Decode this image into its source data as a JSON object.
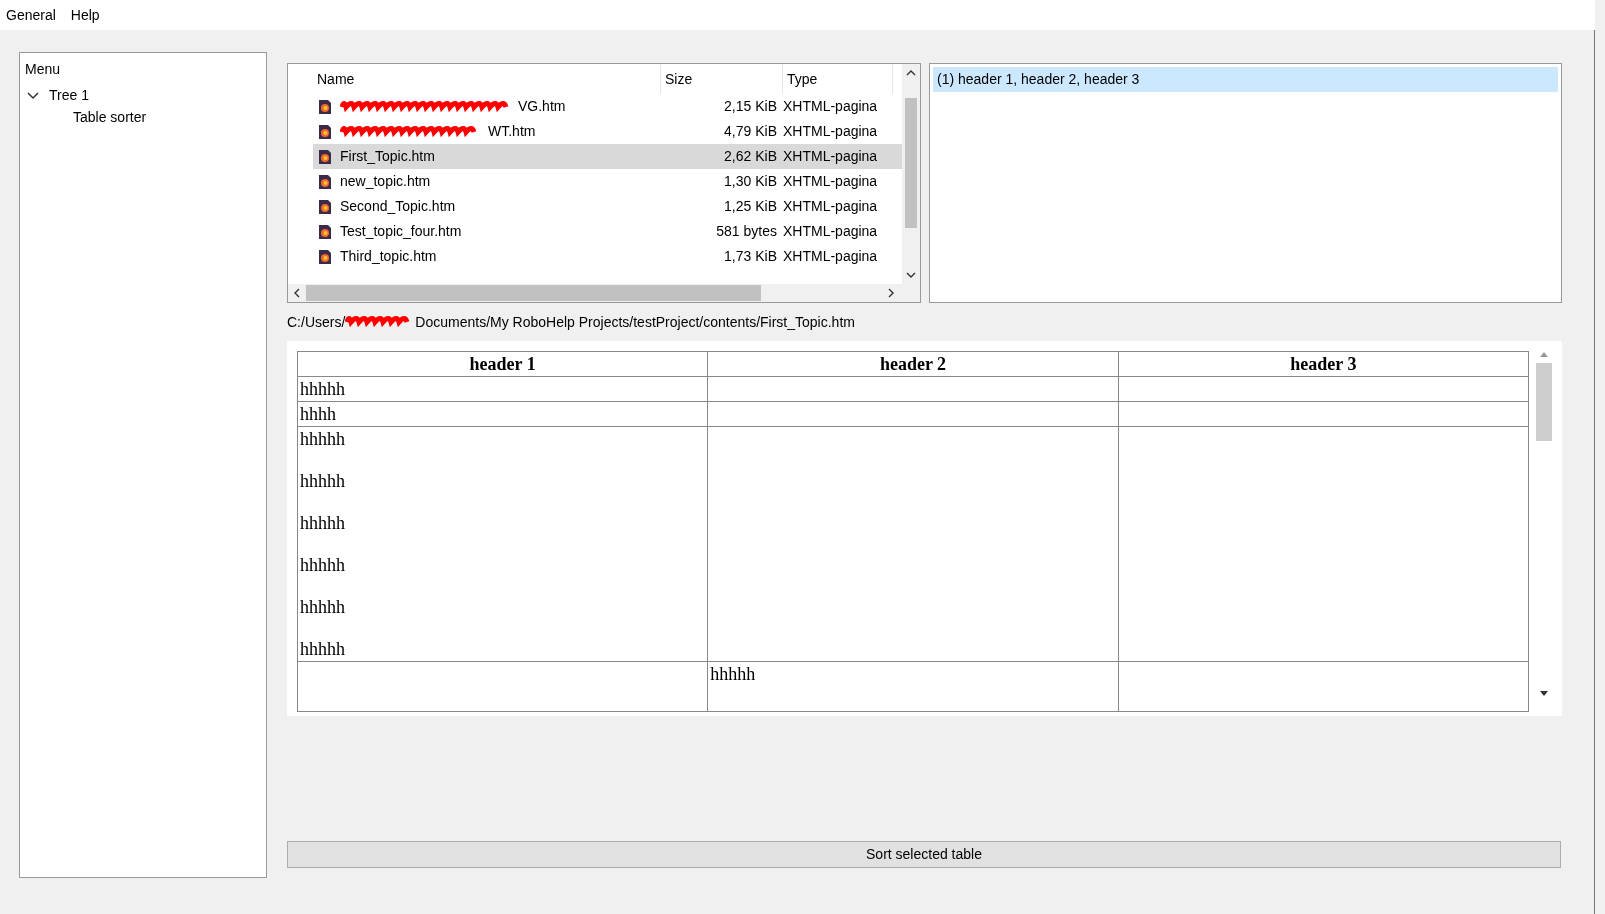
{
  "menu_bar": [
    "General",
    "Help"
  ],
  "sidebar": {
    "title": "Menu",
    "items": [
      {
        "label": "Tree 1",
        "expanded": true,
        "children": [
          {
            "label": "Table sorter"
          }
        ]
      }
    ]
  },
  "files": {
    "columns": [
      "Name",
      "Size",
      "Type"
    ],
    "rows": [
      {
        "name": "VG.htm",
        "redacted": true,
        "size": "2,15 KiB",
        "type": "XHTML-pagina",
        "selected": false
      },
      {
        "name": "WT.htm",
        "redacted": true,
        "size": "4,79 KiB",
        "type": "XHTML-pagina",
        "selected": false
      },
      {
        "name": "First_Topic.htm",
        "redacted": false,
        "size": "2,62 KiB",
        "type": "XHTML-pagina",
        "selected": true
      },
      {
        "name": "new_topic.htm",
        "redacted": false,
        "size": "1,30 KiB",
        "type": "XHTML-pagina",
        "selected": false
      },
      {
        "name": "Second_Topic.htm",
        "redacted": false,
        "size": "1,25 KiB",
        "type": "XHTML-pagina",
        "selected": false
      },
      {
        "name": "Test_topic_four.htm",
        "redacted": false,
        "size": "581 bytes",
        "type": "XHTML-pagina",
        "selected": false
      },
      {
        "name": "Third_topic.htm",
        "redacted": false,
        "size": "1,73 KiB",
        "type": "XHTML-pagina",
        "selected": false
      }
    ]
  },
  "tables_list": [
    {
      "label": "(1) header 1, header 2, header 3",
      "selected": true
    }
  ],
  "path": {
    "before": "C:/Users/",
    "after": "Documents/My RoboHelp Projects/testProject/contents/First_Topic.htm"
  },
  "preview_table": {
    "columns": [
      "header 1",
      "header 2",
      "header 3"
    ],
    "rows": [
      [
        [
          "hhhhh"
        ],
        [],
        []
      ],
      [
        [
          "hhhh"
        ],
        [],
        []
      ],
      [
        [
          "hhhhh",
          "hhhhh",
          "hhhhh",
          "hhhhh",
          "hhhhh",
          "hhhhh"
        ],
        [],
        []
      ],
      [
        [],
        [
          "hhhhh"
        ],
        []
      ]
    ]
  },
  "sort_button": "Sort selected table"
}
